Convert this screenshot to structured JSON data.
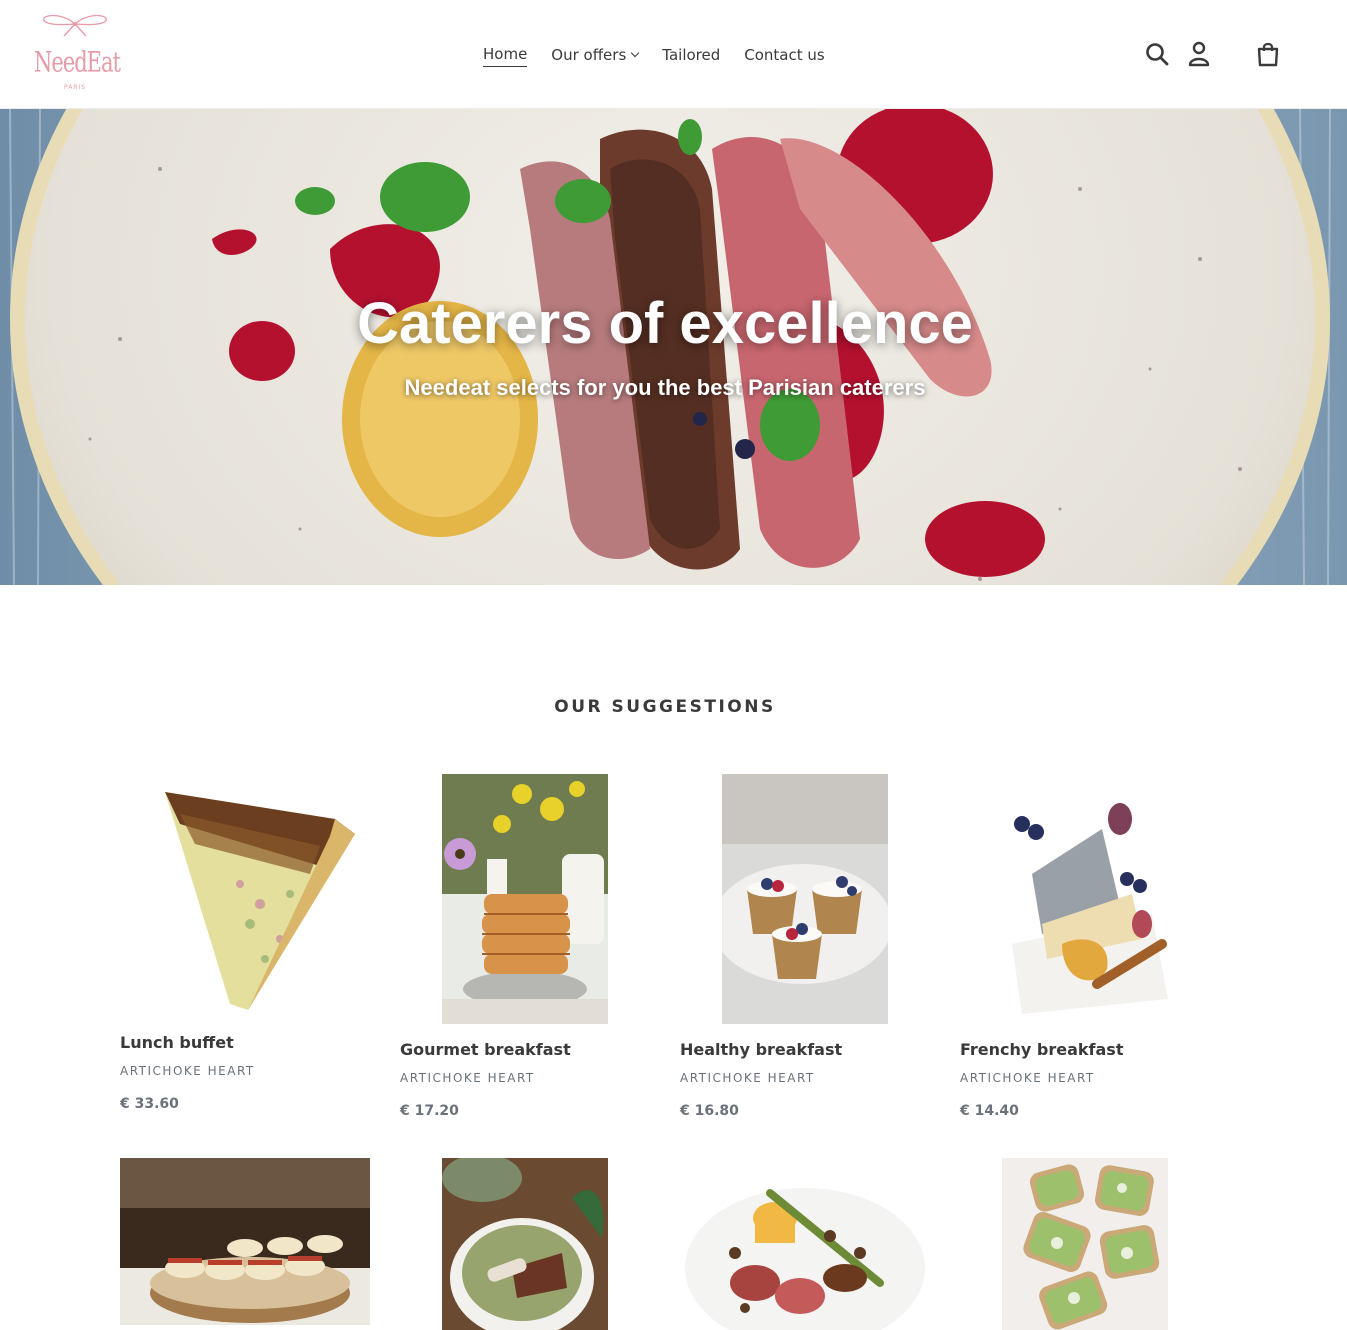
{
  "brand": {
    "logo_text": "NeedEat",
    "logo_sub": "PARIS"
  },
  "nav": {
    "items": [
      {
        "label": "Home"
      },
      {
        "label": "Our offers"
      },
      {
        "label": "Tailored"
      },
      {
        "label": "Contact us"
      }
    ]
  },
  "header_icons": [
    "search-icon",
    "account-icon",
    "cart-icon"
  ],
  "hero": {
    "title": "Caterers of excellence",
    "subtitle": "Needeat selects for you the best Parisian caterers"
  },
  "suggestions": {
    "title": "OUR SUGGESTIONS",
    "products": [
      {
        "name": "Lunch buffet",
        "vendor": "ARTICHOKE HEART",
        "price": "€ 33.60"
      },
      {
        "name": "Gourmet breakfast",
        "vendor": "ARTICHOKE HEART",
        "price": "€ 17.20"
      },
      {
        "name": "Healthy breakfast",
        "vendor": "ARTICHOKE HEART",
        "price": "€ 16.80"
      },
      {
        "name": "Frenchy breakfast",
        "vendor": "ARTICHOKE HEART",
        "price": "€ 14.40"
      },
      {
        "name": "",
        "vendor": "",
        "price": ""
      },
      {
        "name": "",
        "vendor": "",
        "price": ""
      },
      {
        "name": "",
        "vendor": "",
        "price": ""
      },
      {
        "name": "",
        "vendor": "",
        "price": ""
      }
    ]
  },
  "colors": {
    "accent": "#e79aa7",
    "text": "#3a3a3a",
    "muted": "#69727b"
  }
}
